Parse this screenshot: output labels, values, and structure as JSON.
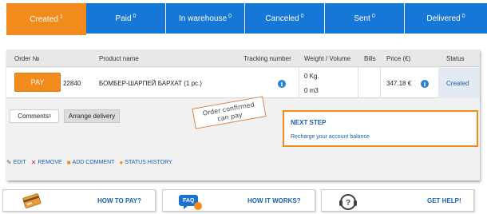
{
  "tabs": [
    {
      "label": "Created",
      "count": "1",
      "active": true
    },
    {
      "label": "Paid",
      "count": "0",
      "active": false
    },
    {
      "label": "In warehouse",
      "count": "0",
      "active": false
    },
    {
      "label": "Canceled",
      "count": "0",
      "active": false
    },
    {
      "label": "Sent",
      "count": "0",
      "active": false
    },
    {
      "label": "Delivered",
      "count": "0",
      "active": false
    }
  ],
  "table": {
    "headers": {
      "order": "Order №",
      "product": "Product name",
      "tracking": "Tracking number",
      "weight": "Weight / Volume",
      "bills": "Bills",
      "price": "Price (€)",
      "status": "Status"
    },
    "row": {
      "pay_label": "PAY",
      "order_number": "22840",
      "product_name": "БОМБЕР-ШАРПЕЙ БАРХАТ (1 pc.)",
      "weight": "0 Kg.",
      "volume": "0 m3",
      "price": "347.18 €",
      "status": "Created"
    }
  },
  "buttons": {
    "comments_label": "Comments",
    "comments_count": "3",
    "arrange_delivery": "Arrange delivery"
  },
  "stamp": {
    "line1": "Order confirmed",
    "line2": "can pay"
  },
  "next_step": {
    "title": "NEXT STEP",
    "text": "Recharge your account balance"
  },
  "actions": {
    "edit": "EDIT",
    "remove": "REMOVE",
    "add_comment": "ADD COMMENT",
    "status_history": "STATUS HISTORY"
  },
  "help": {
    "how_to_pay": "HOW TO PAY?",
    "faq_icon_text": "FAQ",
    "how_it_works": "HOW IT WORKS?",
    "get_help": "GET HELP!"
  },
  "colors": {
    "accent": "#f28a1c",
    "tab_blue": "#1777d6",
    "link_blue": "#1a5fb0",
    "info_blue": "#2a7fd4"
  }
}
